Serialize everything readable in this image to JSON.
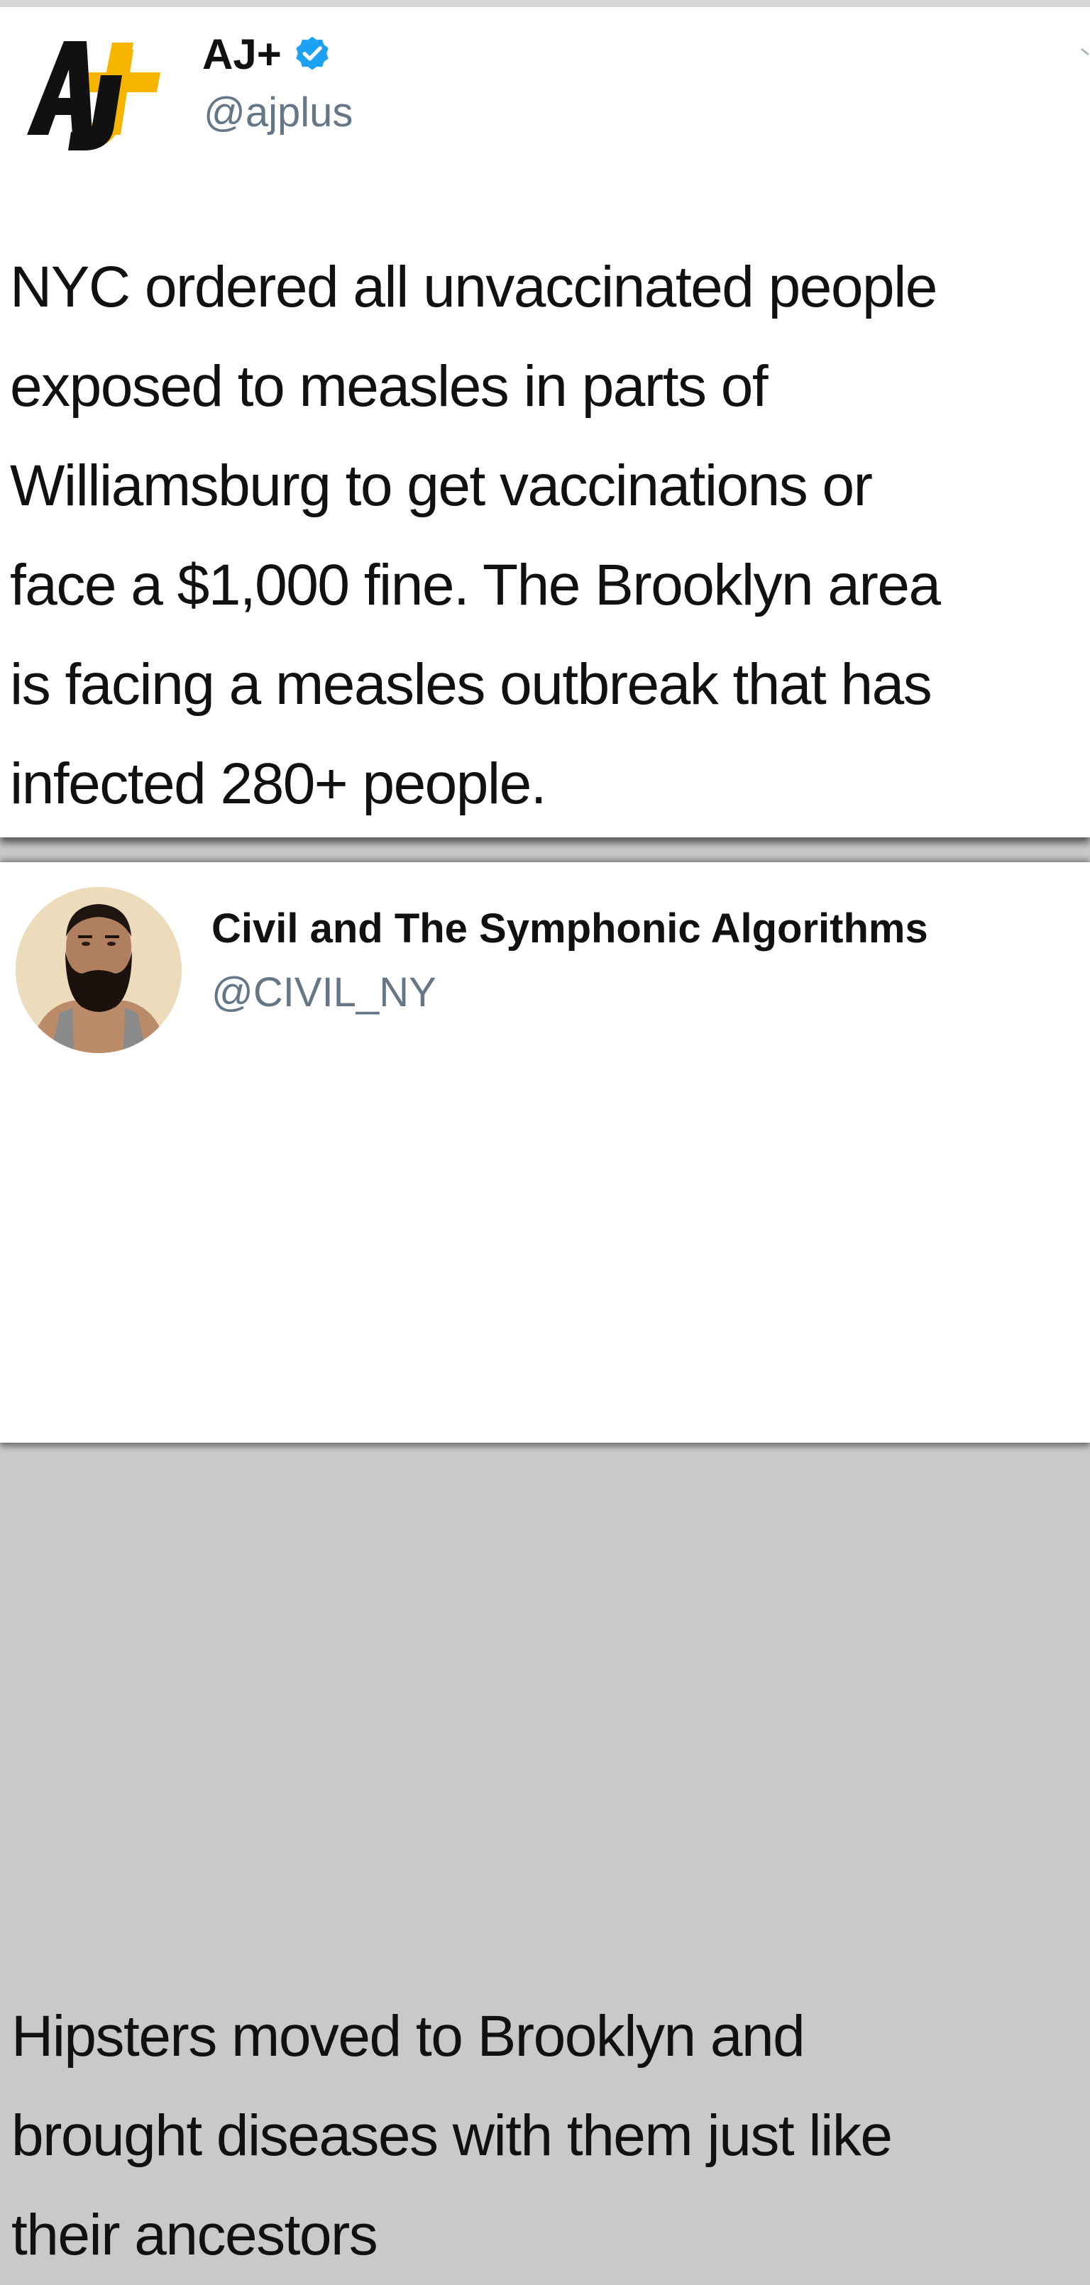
{
  "tweet1": {
    "display_name": "AJ+",
    "verified_icon": "verified-badge-icon",
    "handle": "@ajplus",
    "avatar_icon": "aj-plus-logo",
    "text_lines": [
      "NYC ordered all unvaccinated people",
      "exposed to measles in parts of",
      "Williamsburg to get vaccinations or",
      "face a $1,000 fine. The Brooklyn area",
      "is facing a measles outbreak that has",
      "infected 280+ people."
    ]
  },
  "tweet2": {
    "display_name": "Civil and The Symphonic Algorithms",
    "handle": "@CIVIL_NY",
    "avatar_icon": "profile-photo",
    "text_lines": [
      "Hipsters moved to Brooklyn and",
      "brought diseases with them just like",
      "their ancestors"
    ]
  },
  "colors": {
    "text": "#111111",
    "handle": "#657786",
    "verified": "#1da1f2",
    "logo_black": "#111111",
    "logo_yellow": "#f7b500"
  }
}
